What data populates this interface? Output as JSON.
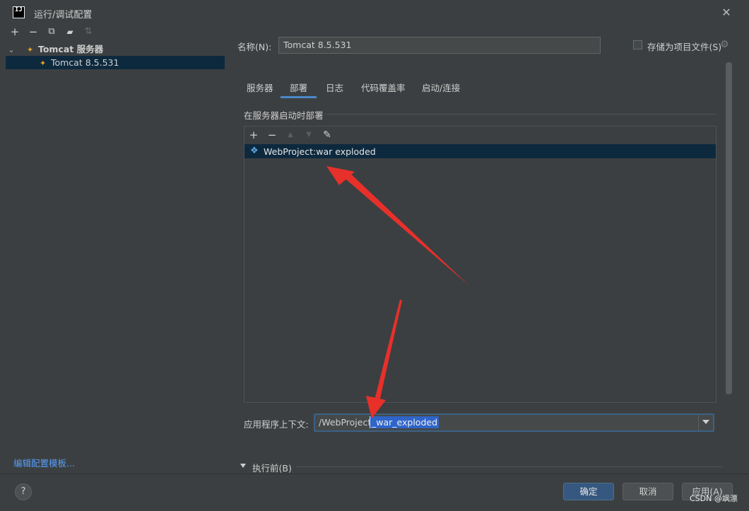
{
  "window": {
    "title": "运行/调试配置",
    "close_glyph": "✕",
    "logo_text": "IJ"
  },
  "left_toolbar": {
    "icons": [
      {
        "name": "add-icon",
        "glyph": "+"
      },
      {
        "name": "remove-icon",
        "glyph": "−"
      },
      {
        "name": "copy-icon",
        "glyph": "⧉"
      },
      {
        "name": "folder-icon",
        "glyph": "▰"
      },
      {
        "name": "sort-icon",
        "glyph": "⇅"
      }
    ]
  },
  "tree": {
    "group_label": "Tomcat 服务器",
    "child_label": "Tomcat 8.5.531",
    "expand_glyph": "⌄"
  },
  "edit_templates_link": "编辑配置模板...",
  "name_field": {
    "label": "名称(N):",
    "value": "Tomcat 8.5.531"
  },
  "store_as_project_file": {
    "label": "存储为项目文件(S)",
    "checked": false
  },
  "tabs": [
    {
      "label": "服务器",
      "active": false
    },
    {
      "label": "部署",
      "active": true
    },
    {
      "label": "日志",
      "active": false
    },
    {
      "label": "代码覆盖率",
      "active": false
    },
    {
      "label": "启动/连接",
      "active": false
    }
  ],
  "deploy": {
    "section_title": "在服务器启动时部署",
    "toolbar": [
      {
        "name": "add-icon",
        "glyph": "+",
        "enabled": true
      },
      {
        "name": "remove-icon",
        "glyph": "−",
        "enabled": true
      },
      {
        "name": "move-up-icon",
        "glyph": "▲",
        "enabled": false
      },
      {
        "name": "move-down-icon",
        "glyph": "▼",
        "enabled": false
      },
      {
        "name": "edit-icon",
        "glyph": "✎",
        "enabled": true
      }
    ],
    "artifacts": [
      "WebProject:war exploded"
    ],
    "context_label": "应用程序上下文:",
    "context_value_plain": "/WebProject",
    "context_value_selected": "_war_exploded"
  },
  "before_launch": {
    "label": "执行前(B)"
  },
  "buttons": {
    "help": "?",
    "ok": "确定",
    "cancel": "取消",
    "apply": "应用(A)"
  },
  "watermark": "CSDN @飒漂",
  "colors": {
    "accent": "#4a88c7",
    "selection": "#0d293e",
    "annotation_arrow": "#e8302a"
  }
}
